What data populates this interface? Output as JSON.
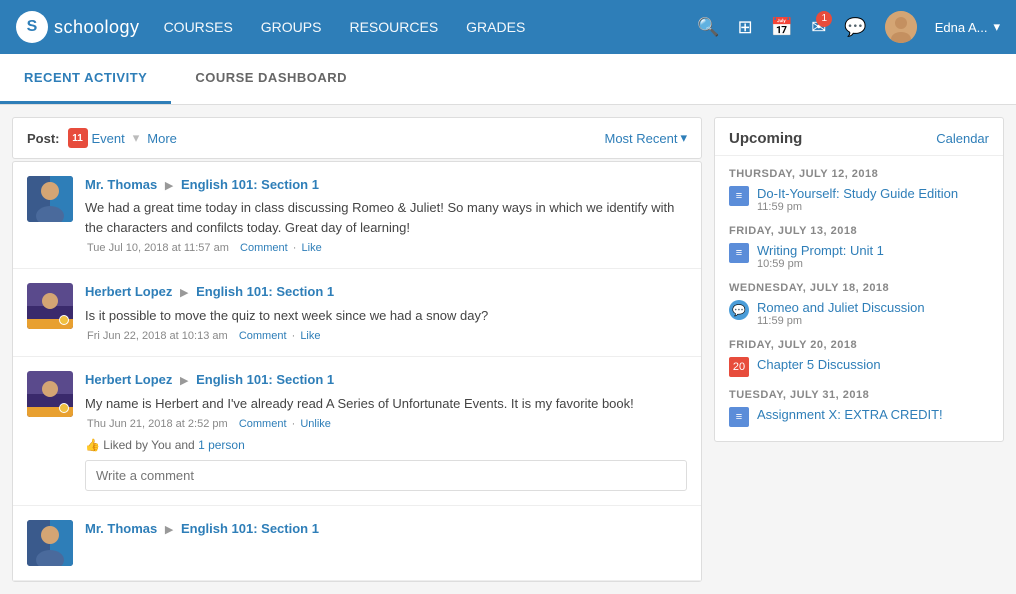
{
  "nav": {
    "logo_text": "schoology",
    "logo_s": "S",
    "links": [
      "COURSES",
      "GROUPS",
      "RESOURCES",
      "GRADES"
    ],
    "notification_count": "1",
    "user_name": "Edna A...",
    "chevron": "▾"
  },
  "tabs": {
    "items": [
      "RECENT ACTIVITY",
      "COURSE DASHBOARD"
    ],
    "active": 0
  },
  "feed": {
    "post_label": "Post:",
    "event_label": "Event",
    "event_num": "11",
    "more_label": "More",
    "most_recent_label": "Most Recent",
    "items": [
      {
        "name": "Mr. Thomas",
        "arrow": "▶",
        "course": "English 101: Section 1",
        "body": "We had a great time today in class discussing Romeo & Juliet! So many ways in which we identify with the characters and confilcts today. Great day of learning!",
        "date": "Tue Jul 10, 2018 at 11:57 am",
        "comment": "Comment",
        "like": "Like",
        "avatar_type": "thomas"
      },
      {
        "name": "Herbert Lopez",
        "arrow": "▶",
        "course": "English 101: Section 1",
        "body": "Is it possible to move the quiz to next week since we had a snow day?",
        "date": "Fri Jun 22, 2018 at 10:13 am",
        "comment": "Comment",
        "like": "Like",
        "avatar_type": "herbert1"
      },
      {
        "name": "Herbert Lopez",
        "arrow": "▶",
        "course": "English 101: Section 1",
        "body": "My name is Herbert and I've already read A Series of Unfortunate Events. It is my favorite book!",
        "date": "Thu Jun 21, 2018 at 2:52 pm",
        "comment": "Comment",
        "unlike": "Unlike",
        "liked_text": "Liked by You and",
        "liked_link": "1 person",
        "comment_placeholder": "Write a comment",
        "avatar_type": "herbert2"
      },
      {
        "name": "Mr. Thomas",
        "arrow": "▶",
        "course": "English 101: Section 1",
        "body": "",
        "avatar_type": "thomas2"
      }
    ]
  },
  "upcoming": {
    "title": "Upcoming",
    "calendar_link": "Calendar",
    "sections": [
      {
        "date_label": "THURSDAY, JULY 12, 2018",
        "items": [
          {
            "icon_type": "assignment",
            "name": "Do-It-Yourself: Study Guide Edition",
            "time": "11:59 pm"
          }
        ]
      },
      {
        "date_label": "FRIDAY, JULY 13, 2018",
        "items": [
          {
            "icon_type": "assignment",
            "name": "Writing Prompt: Unit 1",
            "time": "10:59 pm"
          }
        ]
      },
      {
        "date_label": "WEDNESDAY, JULY 18, 2018",
        "items": [
          {
            "icon_type": "discussion",
            "name": "Romeo and Juliet Discussion",
            "time": "11:59 pm"
          }
        ]
      },
      {
        "date_label": "FRIDAY, JULY 20, 2018",
        "items": [
          {
            "icon_type": "event",
            "icon_num": "20",
            "name": "Chapter 5 Discussion",
            "time": ""
          }
        ]
      },
      {
        "date_label": "TUESDAY, JULY 31, 2018",
        "items": [
          {
            "icon_type": "assignment",
            "name": "Assignment X: EXTRA CREDIT!",
            "time": ""
          }
        ]
      }
    ]
  }
}
